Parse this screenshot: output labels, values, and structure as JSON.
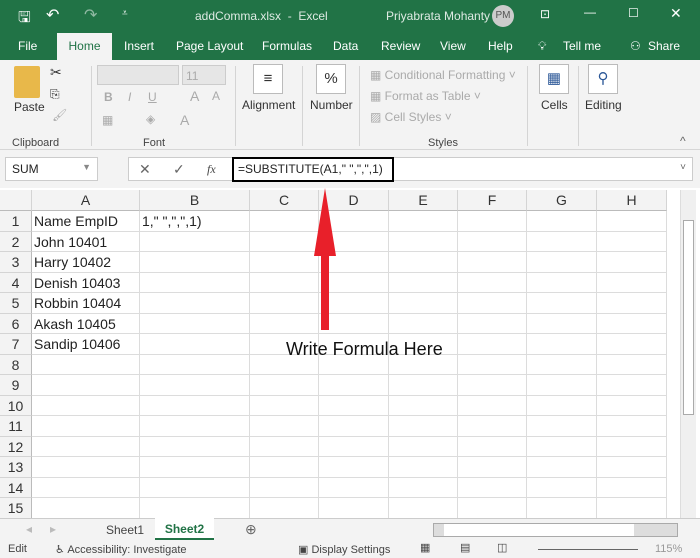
{
  "title_bar": {
    "filename": "addComma.xlsx",
    "app": "Excel",
    "separator": "-",
    "user": "Priyabrata Mohanty",
    "initials": "PM"
  },
  "menu_tabs": [
    "File",
    "Home",
    "Insert",
    "Page Layout",
    "Formulas",
    "Data",
    "Review",
    "View",
    "Help",
    "Tell me",
    "Share"
  ],
  "ribbon": {
    "paste": "Paste",
    "clipboard": "Clipboard",
    "font_size": "11",
    "font": "Font",
    "bold": "B",
    "italic": "I",
    "underline": "U",
    "alignment": "Alignment",
    "number": "Number",
    "percent": "%",
    "conditional": "Conditional Formatting",
    "format_table": "Format as Table",
    "cell_styles": "Cell Styles",
    "styles": "Styles",
    "cells": "Cells",
    "editing": "Editing"
  },
  "formula_bar": {
    "name_box": "SUM",
    "formula": "=SUBSTITUTE(A1,\" \",\",\",1)",
    "fx": "fx"
  },
  "columns": [
    "A",
    "B",
    "C",
    "D",
    "E",
    "F",
    "G",
    "H"
  ],
  "rows": [
    "1",
    "2",
    "3",
    "4",
    "5",
    "6",
    "7",
    "8",
    "9",
    "10",
    "11",
    "12",
    "13",
    "14",
    "15"
  ],
  "cells": {
    "A1": "Name EmpID",
    "B1": "1,\" \",\",\",1)",
    "A2": "John 10401",
    "A3": "Harry 10402",
    "A4": "Denish 10403",
    "A5": "Robbin 10404",
    "A6": "Akash 10405",
    "A7": "Sandip 10406"
  },
  "annotation": {
    "text": "Write Formula Here",
    "color": "#e8202a"
  },
  "sheets": [
    "Sheet1",
    "Sheet2"
  ],
  "active_sheet": "Sheet2",
  "status": {
    "mode": "Edit",
    "accessibility": "Accessibility: Investigate",
    "display": "Display Settings",
    "zoom": "115%"
  }
}
